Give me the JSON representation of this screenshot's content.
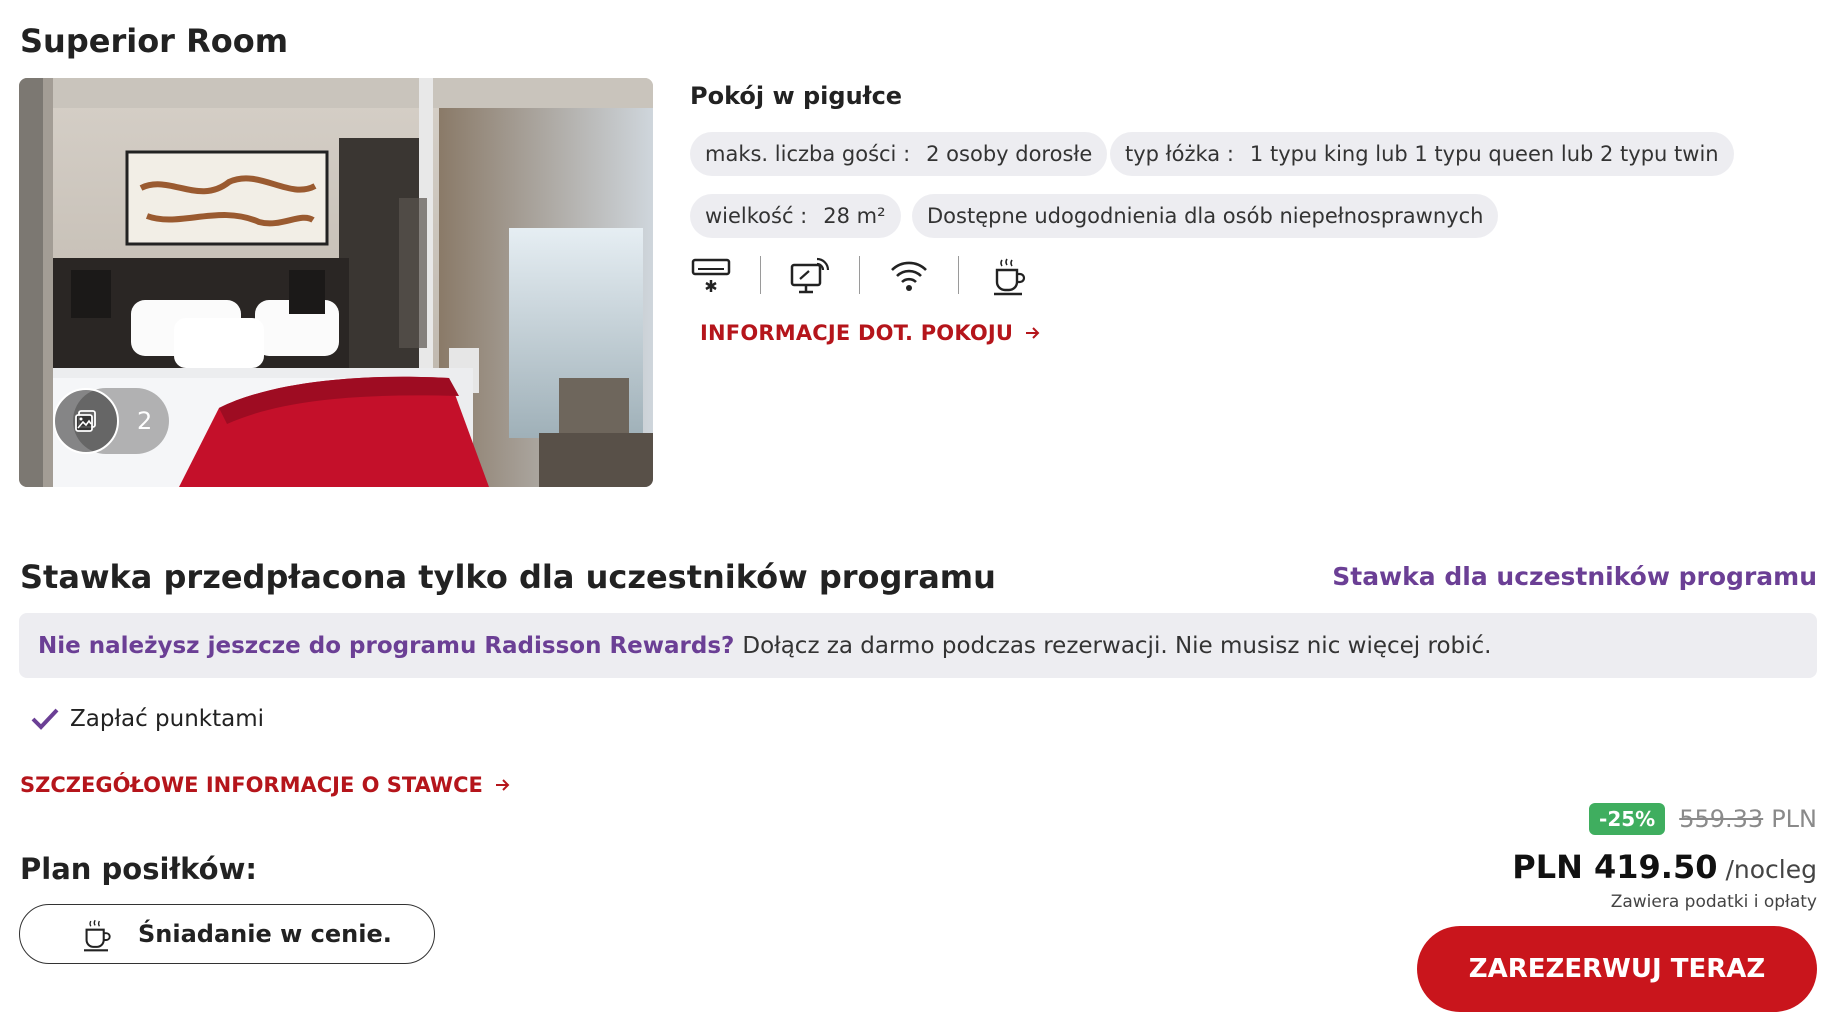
{
  "room": {
    "title": "Superior Room",
    "photo_count": "2",
    "summary_title": "Pokój w pigułce",
    "chips": {
      "guests_label": "maks. liczba gości :",
      "guests_value": "2 osoby dorosłe",
      "bed_label": "typ łóżka :",
      "bed_value": "1 typu king lub 1 typu queen lub 2 typu twin",
      "size_label": "wielkość :",
      "size_value": "28 m²",
      "accessibility": "Dostępne udogodnienia dla osób niepełnosprawnych"
    },
    "amenities": [
      "air-conditioning-icon",
      "smart-tv-icon",
      "wifi-icon",
      "coffee-icon"
    ],
    "info_link": "INFORMACJE DOT. POKOJU"
  },
  "rate": {
    "title": "Stawka przedpłacona tylko dla uczestników programu",
    "member_link": "Stawka dla uczestników programu",
    "banner_link": "Nie należysz jeszcze do programu Radisson Rewards?",
    "banner_text": "Dołącz za darmo podczas rezerwacji. Nie musisz nic więcej robić.",
    "points_text": "Zapłać punktami",
    "details_link": "SZCZEGÓŁOWE INFORMACJE O STAWCE",
    "meal_label": "Plan posiłków:",
    "meal_value": "Śniadanie w cenie."
  },
  "price": {
    "discount": "-25%",
    "old_price": "559.33",
    "old_currency": "PLN",
    "price": "PLN 419.50",
    "per_night": "/nocleg",
    "tax_note": "Zawiera podatki i opłaty"
  },
  "book_button": "ZAREZERWUJ TERAZ",
  "colors": {
    "accent_red": "#c9151c",
    "link_red": "#b5151b",
    "purple": "#6b3f95",
    "discount_green": "#3fae5f",
    "chip_bg": "#ededf1"
  }
}
